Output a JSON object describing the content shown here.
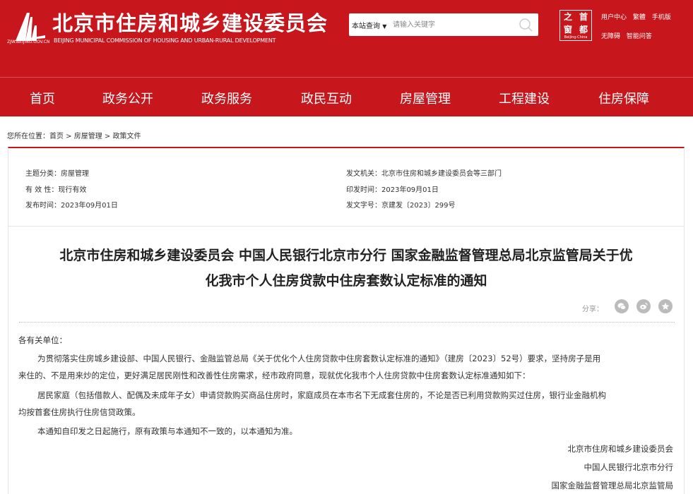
{
  "header": {
    "logo_url": "ZJW.BEIJING.GOV.CN",
    "title": "北京市住房和城乡建设委员会",
    "subtitle": "BEIJING MUNICIPAL COMMISSION OF HOUSING AND URBAN-RURAL DEVELOPMENT",
    "search_scope": "本站查询",
    "search_placeholder": "请输入关键字",
    "seal_chars": [
      "之",
      "首",
      "窗",
      "都"
    ],
    "seal_sub": "Beijing·China",
    "links_row1": [
      "用户中心",
      "繁體",
      "手机版"
    ],
    "links_row2": [
      "无障碍",
      "智能问答"
    ]
  },
  "nav": {
    "items": [
      "首页",
      "政务公开",
      "政务服务",
      "政民互动",
      "房屋管理",
      "工程建设",
      "住房保障"
    ]
  },
  "breadcrumb": {
    "prefix": "您所在位置：",
    "items": [
      "首页",
      "房屋管理",
      "政策文件"
    ],
    "separator": " > "
  },
  "meta": {
    "topic": "主题分类：房屋管理",
    "validity": "有 效 性：现行有效",
    "publish_date": "发布时间：2023年09月01日",
    "issuer": "发文机关：北京市住房和城乡建设委员会等三部门",
    "issue_date": "印发时间：2023年09月01日",
    "doc_number": "发文字号：京建发〔2023〕299号"
  },
  "document": {
    "title_line1": "北京市住房和城乡建设委员会 中国人民银行北京市分行 国家金融监督管理总局北京监管局关于优",
    "title_line2": "化我市个人住房贷款中住房套数认定标准的通知",
    "share_label": "分享：",
    "greeting": "各有关单位：",
    "paragraph1_line1": "为贯彻落实住房城乡建设部、中国人民银行、金融监管总局《关于优化个人住房贷款中住房套数认定标准的通知》（建房〔2023〕52号）要求，坚持房子是用",
    "paragraph1_line2": "来住的、不是用来炒的定位，更好满足居民刚性和改善性住房需求，经市政府同意，现就优化我市个人住房贷款中住房套数认定标准通知如下：",
    "paragraph2_line1": "居民家庭（包括借款人、配偶及未成年子女）申请贷款购买商品住房时，家庭成员在本市名下无成套住房的，不论是否已利用贷款购买过住房，银行业金融机构",
    "paragraph2_line2": "均按首套住房执行住房信贷政策。",
    "paragraph3": "本通知自印发之日起施行，原有政策与本通知不一致的，以本通知为准。",
    "signatures": [
      "北京市住房和城乡建设委员会",
      "中国人民银行北京市分行",
      "国家金融监督管理总局北京监管局"
    ]
  },
  "colors": {
    "brand_red": "#c8161d"
  }
}
